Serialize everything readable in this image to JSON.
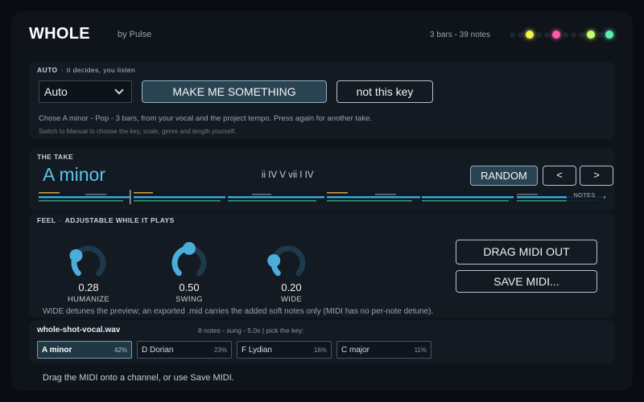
{
  "app": {
    "title": "WHOLE",
    "byline": "by Pulse",
    "meta": "3 bars  -  39 notes",
    "lights": [
      "#1f252d",
      "#1f252d",
      "#f2f24a",
      "#1f252d",
      "#1f252d",
      "#ff5aa8",
      "#1f252d",
      "#1f252d",
      "#1f252d",
      "#c5ff6a",
      "#1f252d",
      "#5ef0b0"
    ]
  },
  "auto": {
    "title": "AUTO",
    "subtitle": "it decides, you listen",
    "mode_value": "Auto",
    "make_label": "MAKE ME SOMETHING",
    "not_key_label": "not this key",
    "description": "Chose A minor  -  Pop  -  3 bars, from your vocal and the project tempo. Press again for another take.",
    "hint": "Switch to Manual to choose the key, scale, genre and length yourself."
  },
  "take": {
    "title": "THE TAKE",
    "key": "A minor",
    "progression": "ii IV V vii I IV",
    "random_label": "RANDOM",
    "prev_label": "<",
    "next_label": ">",
    "notes_label": "NOTES"
  },
  "feel": {
    "title": "FEEL",
    "subtitle": "ADJUSTABLE WHILE IT PLAYS",
    "knobs": [
      {
        "label": "HUMANIZE",
        "value": "0.28",
        "level": 0.28
      },
      {
        "label": "SWING",
        "value": "0.50",
        "level": 0.5
      },
      {
        "label": "WIDE",
        "value": "0.20",
        "level": 0.2
      }
    ],
    "drag_label": "DRAG MIDI OUT",
    "save_label": "SAVE MIDI...",
    "note": "WIDE detunes the preview; an exported .mid carries the added soft notes only (MIDI has no per-note detune)."
  },
  "file": {
    "name": "whole-shot-vocal.wav",
    "info": "8 notes  -  sung  -  5.0s   |   pick the key:",
    "candidates": [
      {
        "key": "A minor",
        "pct": "42%",
        "selected": true
      },
      {
        "key": "D Dorian",
        "pct": "23%",
        "selected": false
      },
      {
        "key": "F Lydian",
        "pct": "16%",
        "selected": false
      },
      {
        "key": "C major",
        "pct": "11%",
        "selected": false
      }
    ]
  },
  "footer": "Drag the MIDI onto a channel, or use Save MIDI.",
  "colors": {
    "accent": "#58c4ea",
    "knob_track": "#1d3a4c",
    "knob_fill": "#4aaed8"
  }
}
